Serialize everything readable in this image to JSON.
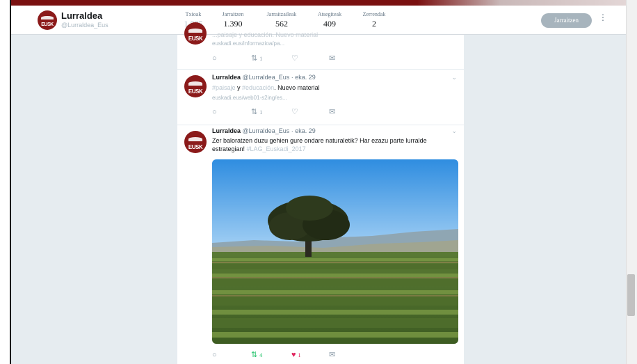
{
  "profile": {
    "name": "Lurraldea",
    "handle": "@Lurraldea_Eus",
    "avatar_text": "EUSK"
  },
  "stats": [
    {
      "label": "Txioak",
      "value": "1.835"
    },
    {
      "label": "Jarraitzen",
      "value": "1.390"
    },
    {
      "label": "Jarraitzaileak",
      "value": "562"
    },
    {
      "label": "Atsegiteak",
      "value": "409"
    },
    {
      "label": "Zerrendak",
      "value": "2"
    }
  ],
  "follow_button": "Jarraitzen",
  "tweets": [
    {
      "partial_text": "...paisaje y educación. Nuevo material",
      "link": "euskadi.eus/informazioa/pa...",
      "retweets": "1"
    },
    {
      "name": "Lurraldea",
      "handle_time": "@Lurraldea_Eus · eka. 29",
      "hashtag_a": "#paisaje",
      "word_y": " y ",
      "hashtag_b": "#educación",
      "text_rest": ". Nuevo material",
      "link": "euskadi.eus/web01-s2ing/es...",
      "retweets": "1"
    },
    {
      "name": "Lurraldea",
      "handle_time": "@Lurraldea_Eus · eka. 29",
      "text": "Zer baloratzen duzu gehien gure ondare naturaletik? Har ezazu parte lurralde estrategian! ",
      "hashtag": "#LAG_Euskadi_2017",
      "retweets": "4",
      "likes": "1"
    }
  ],
  "colors": {
    "brand": "#8b1a1a",
    "retweet_active": "#17bf63",
    "like_active": "#e0245e"
  },
  "icons": [
    "reply-icon",
    "retweet-icon",
    "heart-icon",
    "message-icon",
    "chevron-down-icon",
    "more-icon"
  ]
}
